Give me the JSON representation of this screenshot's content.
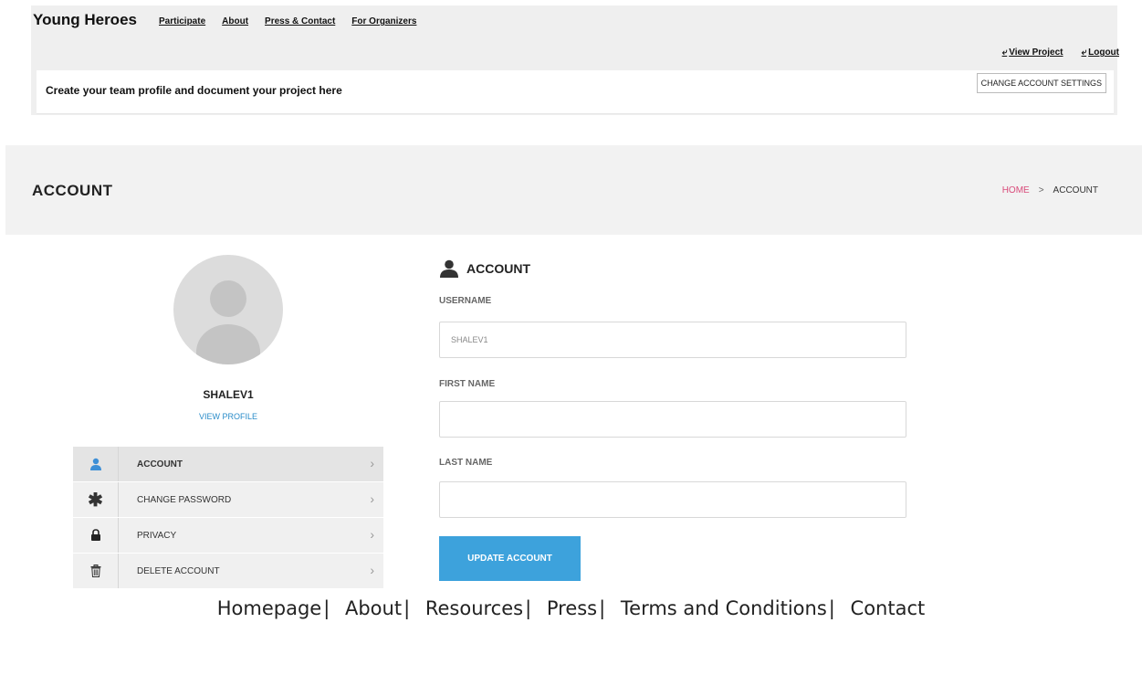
{
  "header": {
    "brand": "Young Heroes",
    "nav": [
      "Participate",
      "About",
      "Press & Contact",
      "For Organizers"
    ],
    "view_project": "View Project",
    "logout": "Logout",
    "tagline": "Create your team profile and document your project here",
    "settings_button": "CHANGE ACCOUNT SETTINGS"
  },
  "banner": {
    "title": "ACCOUNT",
    "breadcrumb_home": "HOME",
    "breadcrumb_sep": ">",
    "breadcrumb_current": "ACCOUNT"
  },
  "profile": {
    "username": "SHALEV1",
    "view_profile": "VIEW PROFILE"
  },
  "menu": [
    {
      "label": "ACCOUNT",
      "icon": "user-icon"
    },
    {
      "label": "CHANGE PASSWORD",
      "icon": "asterisk-icon"
    },
    {
      "label": "PRIVACY",
      "icon": "lock-icon"
    },
    {
      "label": "DELETE ACCOUNT",
      "icon": "trash-icon"
    }
  ],
  "form": {
    "heading": "ACCOUNT",
    "username_label": "USERNAME",
    "username_value": "SHALEV1",
    "first_name_label": "FIRST NAME",
    "first_name_value": "",
    "last_name_label": "LAST NAME",
    "last_name_value": "",
    "submit": "UPDATE ACCOUNT"
  },
  "footer": {
    "links": [
      "Homepage",
      "About",
      "Resources",
      "Press",
      "Terms and Conditions",
      "Contact"
    ],
    "separator": "|"
  },
  "colors": {
    "accent": "#3da2dc",
    "breadcrumb_home": "#d94c7b",
    "active_icon": "#3d8fd6"
  }
}
